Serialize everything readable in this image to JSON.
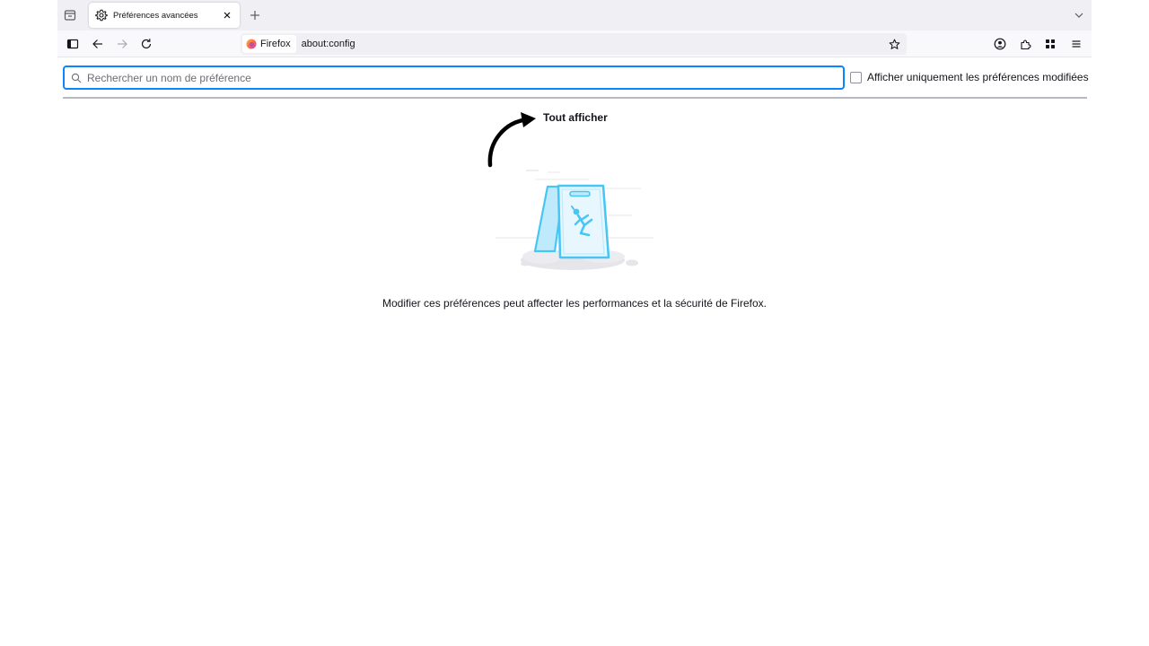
{
  "browser": {
    "tab": {
      "title": "Préférences avancées"
    },
    "identity_label": "Firefox",
    "url": "about:config"
  },
  "config": {
    "search_placeholder": "Rechercher un nom de préférence",
    "search_value": "",
    "modified_only_label": "Afficher uniquement les préférences modifiées",
    "modified_only_checked": false,
    "show_all_label": "Tout afficher",
    "warning_text": "Modifier ces préférences peut affecter les performances et la sécurité de Firefox."
  },
  "icons": {
    "tab_overview": "tab-overview-icon",
    "settings": "gear-icon",
    "close": "close-icon",
    "new_tab": "plus-icon",
    "list_all_tabs": "chevron-down-icon",
    "sidebar": "sidebar-icon",
    "back": "back-arrow-icon",
    "forward": "forward-arrow-icon",
    "reload": "reload-icon",
    "bookmark": "star-icon",
    "account": "account-icon",
    "extensions": "puzzle-icon",
    "apps": "apps-grid-icon",
    "menu": "hamburger-menu-icon",
    "search": "search-icon"
  },
  "colors": {
    "accent": "#0a84ff",
    "illustration": "#45c6f5"
  }
}
